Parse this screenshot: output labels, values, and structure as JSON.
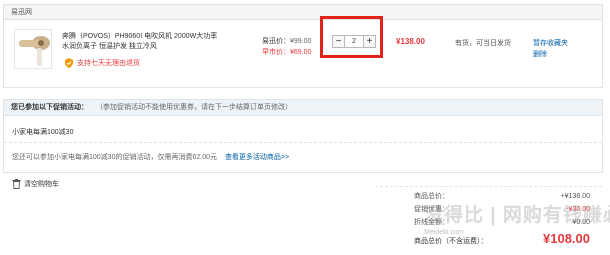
{
  "seller": {
    "name": "易迅网"
  },
  "item": {
    "name": "奔腾（POVOS）PH9060I 电吹风机 2000W大功率 水润负离子 恒温护发 独立冷风",
    "promise": "支持七天无理由退货",
    "price_label": "易迅价：",
    "price": "¥99.00",
    "vip_label": "早市价：",
    "vip_price": "¥69.00",
    "quantity": "2",
    "minus": "−",
    "plus": "+",
    "subtotal": "¥138.00",
    "stock": "有货，可当日发货",
    "actions": [
      "暂存收藏夹",
      "删除"
    ]
  },
  "promotion": {
    "title": "您已参加以下促销活动：",
    "note": "（参加促销活动不能使用优惠券，请在下一步结算订单页修改）",
    "name": "小家电每满100减30",
    "status": "您还可以参加小家电每满100减30的促销活动，仅需再消费62.00元",
    "more_link": "查看更多活动商品>>"
  },
  "cart": {
    "clear_label": "清空购物车"
  },
  "totals": {
    "rows": [
      {
        "label": "商品总价：",
        "value": "+¥138.00",
        "red": false
      },
      {
        "label": "促销优惠：",
        "value": "-¥30.00",
        "red": true
      },
      {
        "label": "折线金额：",
        "value": "¥0.00",
        "red": false
      }
    ],
    "grand_label": "商品总价（不含运费）：",
    "grand_value": "¥108.00"
  },
  "watermark": {
    "text": "没得比 | 网购有钱赚必读",
    "site": "Meidebi.com"
  },
  "colors": {
    "accent_red": "#e4393c",
    "link_blue": "#005ea7",
    "highlight_red": "#e2231a",
    "promo_orange": "#f39800"
  }
}
